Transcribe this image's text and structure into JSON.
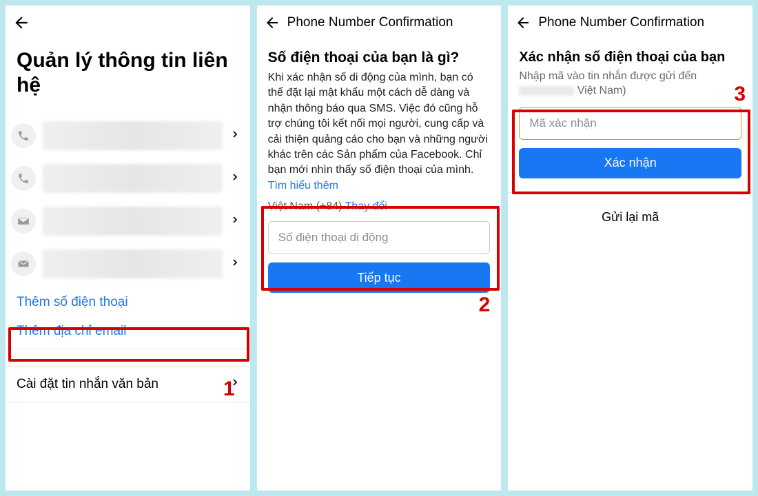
{
  "colors": {
    "primary": "#1877f2",
    "annotation": "#d60000"
  },
  "screen1": {
    "title": "Quản lý thông tin liên hệ",
    "contacts": [
      {
        "icon": "phone"
      },
      {
        "icon": "phone"
      },
      {
        "icon": "mail"
      },
      {
        "icon": "mail"
      }
    ],
    "add_phone": "Thêm số điện thoại",
    "add_email": "Thêm địa chỉ email",
    "sms_settings": "Cài đặt tin nhắn văn bản",
    "annotation_number": "1"
  },
  "screen2": {
    "header_title": "Phone Number Confirmation",
    "heading": "Số điện thoại của bạn là gì?",
    "paragraph": "Khi xác nhận số di động của mình, bạn có thể đặt lại mật khẩu một cách dễ dàng và nhận thông báo qua SMS. Việc đó cũng hỗ trợ chúng tôi kết nối mọi người, cung cấp và cải thiện quảng cáo cho bạn và những người khác trên các Sản phẩm của Facebook. Chỉ bạn mới nhìn thấy số điện thoại của mình.",
    "learn_more": "Tìm hiểu thêm",
    "country_prefix": "Việt Nam (+84)",
    "change_link": "Thay đổi",
    "phone_placeholder": "Số điện thoại di động",
    "continue_btn": "Tiếp tục",
    "annotation_number": "2"
  },
  "screen3": {
    "header_title": "Phone Number Confirmation",
    "heading": "Xác nhận số điện thoại của bạn",
    "subtitle_pre": "Nhập mã vào tin nhắn được gửi đến",
    "subtitle_post": "Việt Nam)",
    "code_placeholder": "Mã xác nhận",
    "confirm_btn": "Xác nhận",
    "resend_btn": "Gửi lại mã",
    "annotation_number": "3"
  }
}
